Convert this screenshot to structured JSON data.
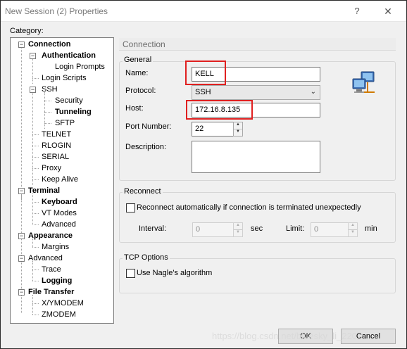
{
  "window": {
    "title": "New Session (2) Properties",
    "help_glyph": "?",
    "close_glyph": "✕"
  },
  "category_label": "Category:",
  "tree": {
    "connection": "Connection",
    "authentication": "Authentication",
    "login_prompts": "Login Prompts",
    "login_scripts": "Login Scripts",
    "ssh": "SSH",
    "security": "Security",
    "tunneling": "Tunneling",
    "sftp": "SFTP",
    "telnet": "TELNET",
    "rlogin": "RLOGIN",
    "serial": "SERIAL",
    "proxy": "Proxy",
    "keep_alive": "Keep Alive",
    "terminal": "Terminal",
    "keyboard": "Keyboard",
    "vt_modes": "VT Modes",
    "advanced_term": "Advanced",
    "appearance": "Appearance",
    "margins": "Margins",
    "advanced": "Advanced",
    "trace": "Trace",
    "logging": "Logging",
    "file_transfer": "File Transfer",
    "xymodem": "X/YMODEM",
    "zmodem": "ZMODEM"
  },
  "panel": {
    "header": "Connection",
    "general": {
      "title": "General",
      "name_label": "Name:",
      "name_value": "KELL",
      "protocol_label": "Protocol:",
      "protocol_value": "SSH",
      "host_label": "Host:",
      "host_value": "172.16.8.135",
      "port_label": "Port Number:",
      "port_value": "22",
      "description_label": "Description:",
      "description_value": ""
    },
    "reconnect": {
      "title": "Reconnect",
      "checkbox_label": "Reconnect automatically if connection is terminated unexpectedly",
      "checked": false,
      "interval_label": "Interval:",
      "interval_value": "0",
      "interval_unit": "sec",
      "limit_label": "Limit:",
      "limit_value": "0",
      "limit_unit": "min"
    },
    "tcp": {
      "title": "TCP Options",
      "nagle_label": "Use Nagle's algorithm",
      "checked": false
    }
  },
  "buttons": {
    "ok": "OK",
    "cancel": "Cancel"
  },
  "watermark": "https://blog.csdn.net/bluesky_li_220",
  "colors": {
    "highlight_box": "#e02020",
    "window_bg": "#f0f0f0"
  },
  "icons": {
    "session_icon": "network-computers-icon"
  }
}
